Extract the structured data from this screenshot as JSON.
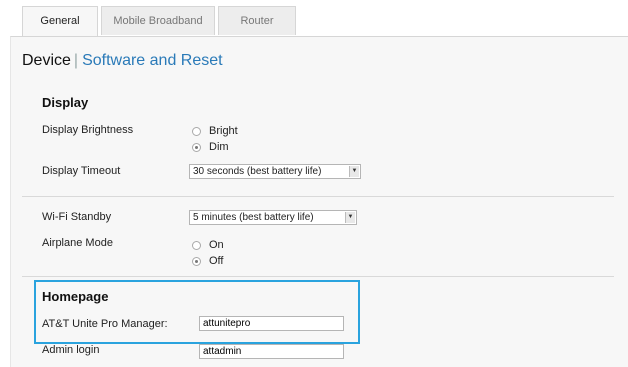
{
  "tabs": [
    "General",
    "Mobile Broadband",
    "Router"
  ],
  "breadcrumb": {
    "current": "Device",
    "separator": "|",
    "link": "Software and Reset"
  },
  "display": {
    "title": "Display",
    "brightness": {
      "label": "Display Brightness",
      "options": [
        "Bright",
        "Dim"
      ],
      "selected": "Dim"
    },
    "timeout": {
      "label": "Display Timeout",
      "value": "30 seconds (best battery life)"
    }
  },
  "wifi": {
    "label": "Wi-Fi Standby",
    "value": "5 minutes (best battery life)"
  },
  "airplane": {
    "label": "Airplane Mode",
    "options": [
      "On",
      "Off"
    ],
    "selected": "Off"
  },
  "homepage": {
    "title": "Homepage",
    "manager_label": "AT&T Unite Pro Manager:",
    "manager_value": "attunitepro",
    "admin_label": "Admin login",
    "admin_value": "attadmin"
  },
  "colors": {
    "link": "#2a7ab8",
    "highlight": "#2aa3de"
  }
}
